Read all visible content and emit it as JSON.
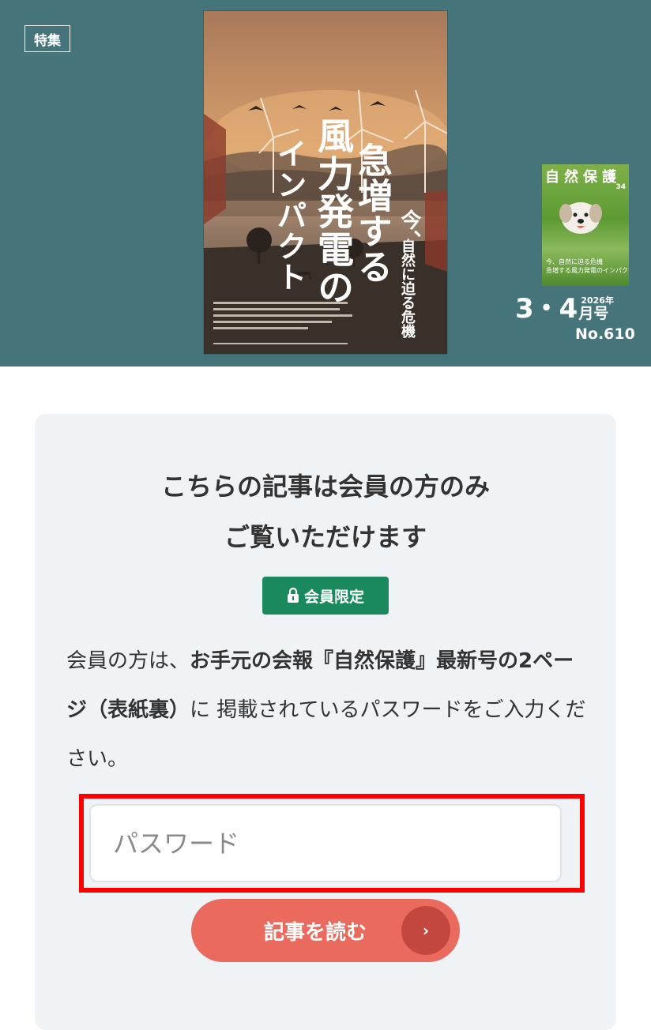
{
  "hero": {
    "tag": "特集",
    "cover": {
      "title_1": "急増する",
      "title_2": "風力発電の",
      "title_3": "インパクト",
      "sub_1": "今、",
      "sub_2": "自然に迫る危機"
    },
    "mini_cover": {
      "title": "自然保護",
      "number": "34",
      "caption_1": "今、自然に迫る危機",
      "caption_2": "急増する風力発電のインパクト"
    },
    "issue": {
      "main": "3・4",
      "year": "2026年",
      "month": "月号",
      "no": "No.610"
    }
  },
  "card": {
    "heading_line1": "こちらの記事は会員の方のみ",
    "heading_line2": "ご覧いただけます",
    "badge": "会員限定",
    "desc_1": "会員の方は、",
    "desc_bold_1": "お手元の会報『自然保護』最新号の2ページ（表紙裏）",
    "desc_2": "に 掲載されているパスワードをご入力ください。",
    "password_placeholder": "パスワード",
    "read_button": "記事を読む",
    "read_arrow": "›"
  },
  "colors": {
    "hero_bg": "#46747b",
    "card_bg": "#f0f3f6",
    "badge_green": "#1a8a5e",
    "button_coral": "#ea6a5e",
    "highlight_red": "#ff0000"
  }
}
